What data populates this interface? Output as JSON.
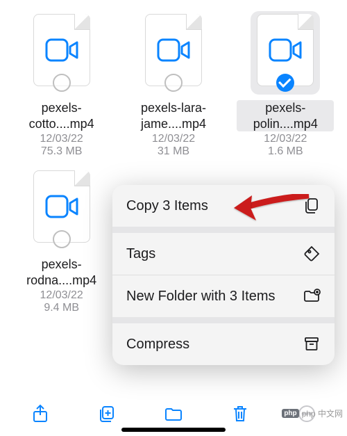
{
  "files": [
    {
      "name": "pexels-cotto....mp4",
      "date": "12/03/22",
      "size": "75.3 MB",
      "selected": false
    },
    {
      "name": "pexels-lara-jame....mp4",
      "date": "12/03/22",
      "size": "31 MB",
      "selected": false
    },
    {
      "name": "pexels-polin....mp4",
      "date": "12/03/22",
      "size": "1.6 MB",
      "selected": true
    },
    {
      "name": "pexels-rodna....mp4",
      "date": "12/03/22",
      "size": "9.4 MB",
      "selected": false
    }
  ],
  "menu": {
    "copy": "Copy 3 Items",
    "tags": "Tags",
    "new_folder": "New Folder with 3 Items",
    "compress": "Compress"
  },
  "colors": {
    "accent": "#0a84ff",
    "muted": "#8e8e93",
    "arrow": "#cb1d1a"
  },
  "watermark": "php 中文网"
}
